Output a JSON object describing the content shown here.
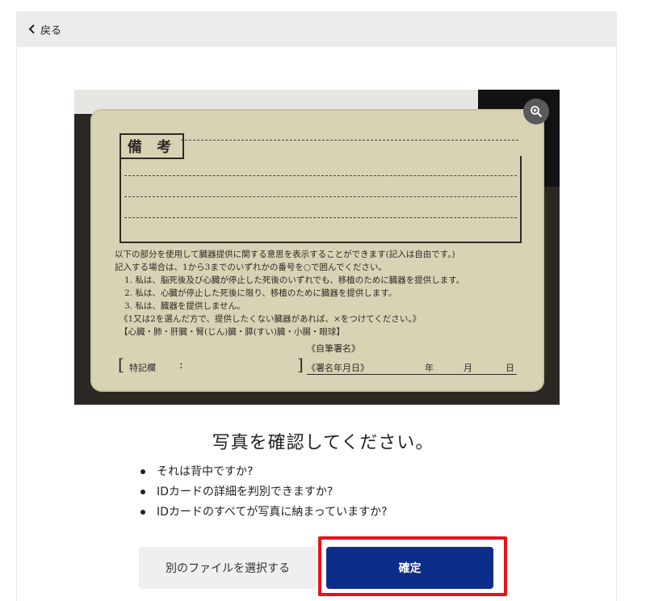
{
  "topbar": {
    "back_label": "戻る"
  },
  "photo": {
    "card_heading": "備 考",
    "card_lines": [
      "以下の部分を使用して臓器提供に関する意思を表示することができます(記入は自由です。)",
      "記入する場合は、1から3までのいずれかの番号を○で囲んでください。",
      "1. 私は、脳死後及び心臓が停止した死後のいずれでも、移植のために臓器を提供します。",
      "2. 私は、心臓が停止した死後に限り、移植のために臓器を提供します。",
      "3. 私は、臓器を提供しません。",
      "《1又は2を選んだ方で、提供したくない臓器があれば、×をつけてください。》",
      "【心臓・肺・肝臓・腎(じん)臓・膵(すい)臓・小腸・眼球】"
    ],
    "card_footer": {
      "special_label": "特記欄",
      "colon": ":",
      "signature_label": "《自筆署名》",
      "date_label": "《署名年月日》",
      "year": "年",
      "month": "月",
      "day": "日"
    },
    "zoom_icon": "zoom-in-icon"
  },
  "main": {
    "title": "写真を確認してください。",
    "checklist": [
      "それは背中ですか?",
      "IDカードの詳細を判別できますか?",
      "IDカードのすべてが写真に納まっていますか?"
    ]
  },
  "actions": {
    "alt_label": "別のファイルを選択する",
    "confirm_label": "確定"
  },
  "colors": {
    "confirm_button": "#0c2d8a",
    "highlight": "#e8131a",
    "topbar": "#ececec"
  }
}
